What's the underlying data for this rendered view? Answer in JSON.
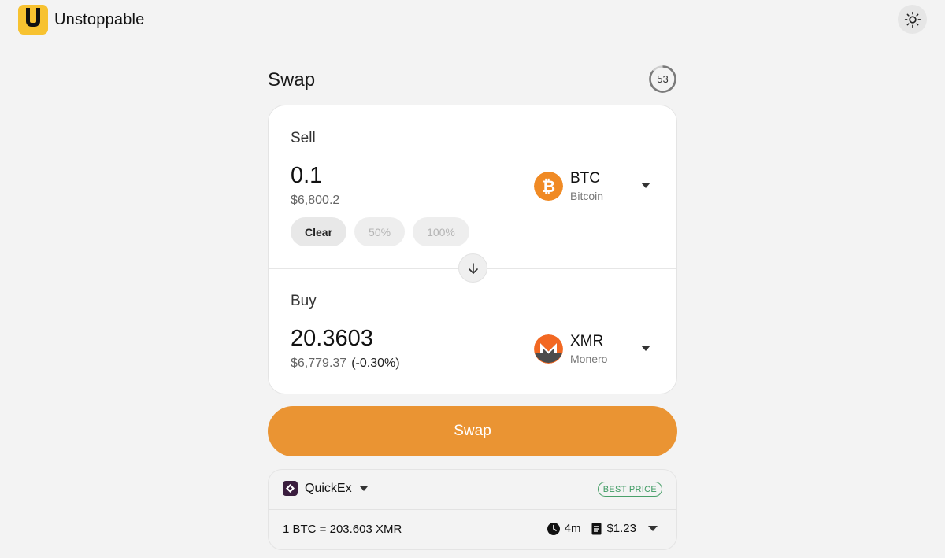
{
  "header": {
    "app_name": "Unstoppable",
    "logo_icon": "unstoppable-logo",
    "theme_icon": "sun-icon"
  },
  "swap": {
    "title": "Swap",
    "timer_value": "53",
    "sell": {
      "label": "Sell",
      "amount": "0.1",
      "usd_value": "$6,800.2",
      "token_symbol": "BTC",
      "token_name": "Bitcoin",
      "token_color": "#f08a24",
      "buttons": [
        "Clear",
        "50%",
        "100%"
      ]
    },
    "buy": {
      "label": "Buy",
      "amount": "20.3603",
      "usd_value": "$6,779.37",
      "price_diff": "(-0.30%)",
      "token_symbol": "XMR",
      "token_name": "Monero",
      "token_color": "#f26822"
    },
    "swap_button": "Swap",
    "accent_color": "#ea9433"
  },
  "provider": {
    "name": "QuickEx",
    "badge": "BEST PRICE",
    "rate": "1 BTC = 203.603 XMR",
    "time": "4m",
    "fee": "$1.23"
  }
}
